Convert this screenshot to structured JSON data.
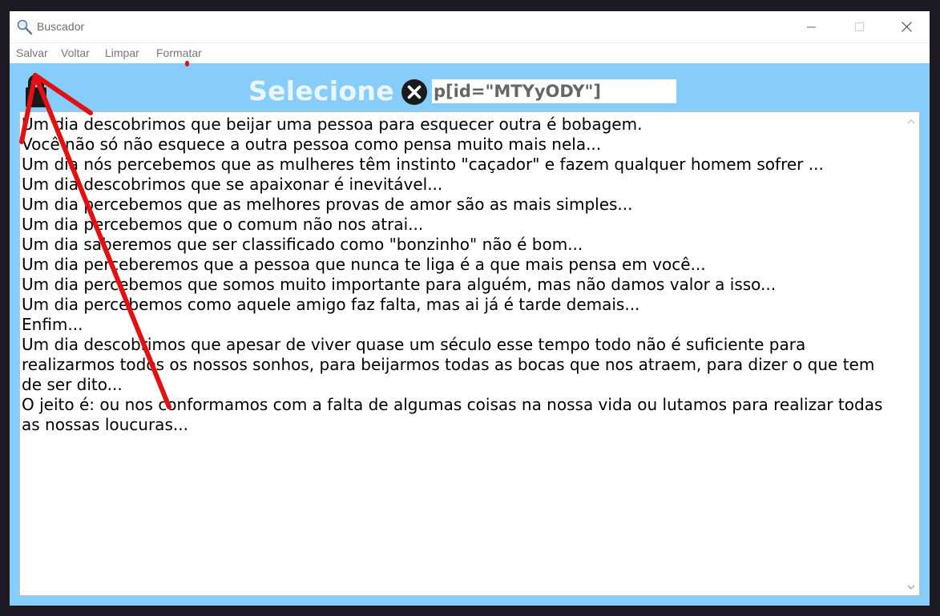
{
  "window": {
    "title": "Buscador",
    "app_icon": "magnifier-icon",
    "controls": {
      "minimize_icon": "minimize-icon",
      "maximize_icon": "maximize-icon",
      "close_icon": "close-icon"
    }
  },
  "menu": {
    "salvar": "Salvar",
    "voltar": "Voltar",
    "limpar": "Limpar",
    "formatar": "Formatar"
  },
  "toolbar": {
    "lock_icon": "lock-icon",
    "select_label": "Selecione",
    "clear_icon": "clear-circle-icon",
    "selector_value": "p[id=\"MTYyODY\"]"
  },
  "content": {
    "lines": [
      "Um dia descobrimos que beijar uma pessoa para esquecer outra é bobagem.",
      "Você não só não esquece a outra pessoa como pensa muito mais nela...",
      "Um dia nós percebemos que as mulheres têm instinto \"caçador\" e fazem qualquer homem sofrer ...",
      "Um dia descobrimos que se apaixonar é inevitável...",
      "Um dia percebemos que as melhores provas de amor são as mais simples...",
      "Um dia percebemos que o comum não nos atrai...",
      "Um dia saberemos que ser classificado como \"bonzinho\" não é bom...",
      "Um dia perceberemos que a pessoa que nunca te liga é a que mais pensa em você...",
      "Um dia percebemos que somos muito importante para alguém, mas não damos valor a isso...",
      "Um dia percebemos como aquele amigo faz falta, mas ai já é tarde demais...",
      "Enfim...",
      "Um dia descobrimos que apesar de viver quase um século esse tempo todo não é suficiente para realizarmos todos os nossos sonhos, para beijarmos todas as bocas que nos atraem, para dizer o que tem de ser dito...",
      "O jeito é: ou nos conformamos com a falta de algumas coisas na nossa vida ou lutamos para realizar todas as nossas loucuras..."
    ]
  },
  "colors": {
    "window_background": "#87cdfc",
    "annotation_arrow": "#e01010"
  }
}
